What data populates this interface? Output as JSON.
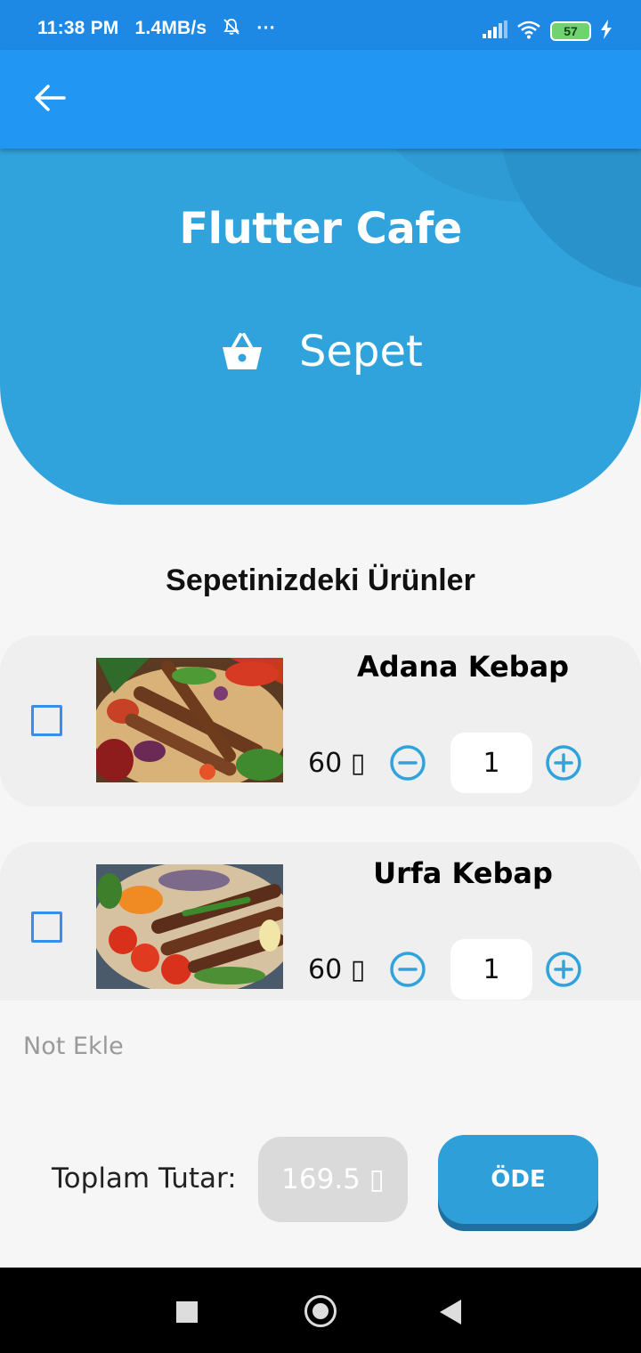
{
  "status_bar": {
    "time": "11:38 PM",
    "speed": "1.4MB/s",
    "more": "···",
    "battery": "57"
  },
  "app_bar": {
    "back_icon": "arrow-back-icon"
  },
  "hero": {
    "title": "Flutter Cafe",
    "subtitle": "Sepet",
    "icon": "shopping-basket-icon"
  },
  "cart": {
    "section_title": "Sepetinizdeki Ürünler",
    "items": [
      {
        "name": "Adana Kebap",
        "price": "60 ▯",
        "quantity": "1",
        "checked": false
      },
      {
        "name": "Urfa Kebap",
        "price": "60 ▯",
        "quantity": "1",
        "checked": false
      }
    ]
  },
  "note": {
    "placeholder": "Not Ekle"
  },
  "footer": {
    "total_label": "Toplam Tutar:",
    "total_value": "169.5 ▯",
    "pay_label": "ÖDE"
  },
  "colors": {
    "app_bar": "#2196f3",
    "status_bar": "#1e88e5",
    "hero": "#31a3dc",
    "accent": "#2e9fd8",
    "checkbox": "#3a8ee6"
  }
}
